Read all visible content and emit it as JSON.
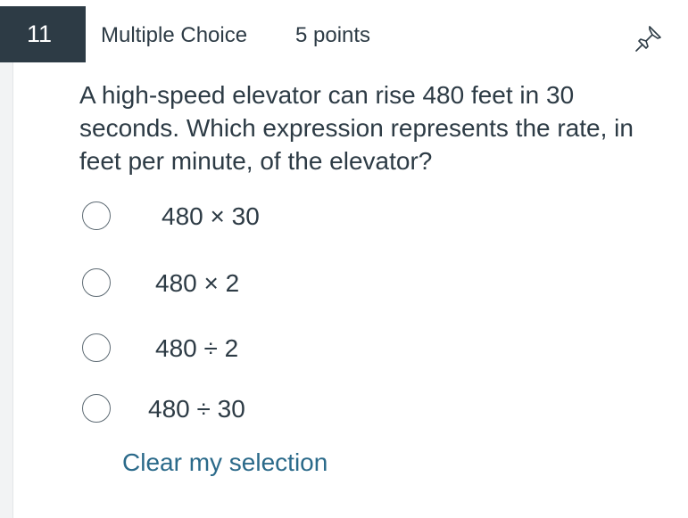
{
  "question": {
    "number": "11",
    "type": "Multiple Choice",
    "points": "5 points",
    "prompt": "A high-speed elevator can rise 480 feet in 30 seconds. Which expression represents the rate, in feet per minute, of the elevator?",
    "pin_icon": "pushpin-icon"
  },
  "choices": [
    {
      "label": "480 × 30",
      "selected": false
    },
    {
      "label": "480 × 2",
      "selected": false
    },
    {
      "label": "480 ÷ 2",
      "selected": false
    },
    {
      "label": "480 ÷ 30",
      "selected": false
    }
  ],
  "clear_label": "Clear my selection",
  "colors": {
    "number_badge_bg": "#2d3b45",
    "text": "#2d3b45",
    "link": "#2b6a8a"
  }
}
